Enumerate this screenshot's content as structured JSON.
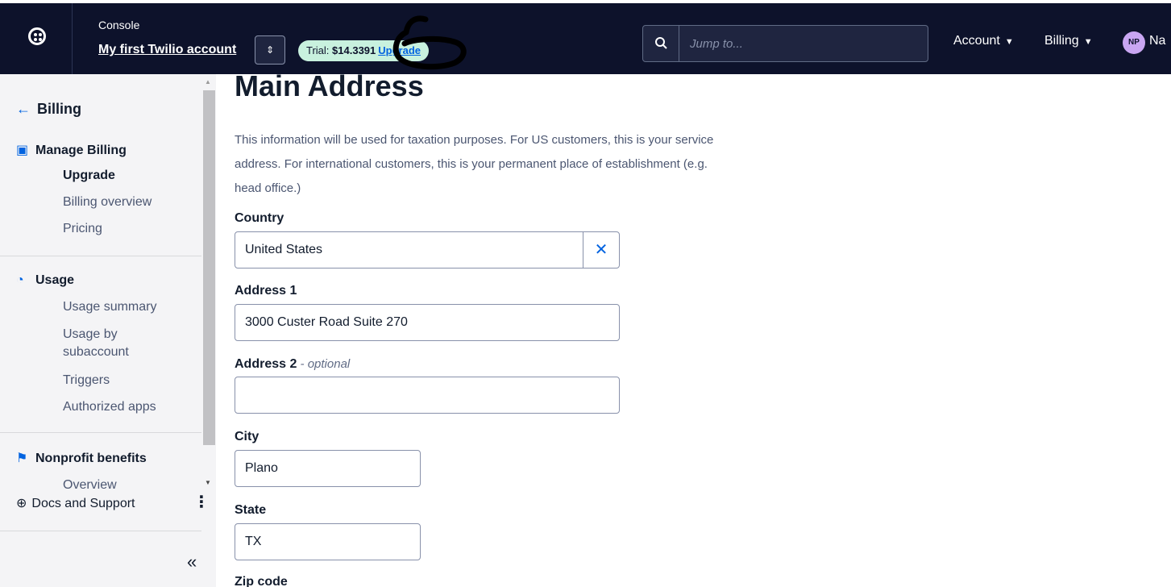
{
  "topbar": {
    "console_label": "Console",
    "account_name": "My first Twilio account",
    "switch_icon": "⌃⌄",
    "trial_label": "Trial: ",
    "trial_amount": "$14.3391",
    "upgrade_link": "Upgrade",
    "search_placeholder": "Jump to...",
    "menus": [
      {
        "label": "Account"
      },
      {
        "label": "Billing"
      }
    ],
    "avatar_initials": "NP",
    "user_name": "Na"
  },
  "sidebar": {
    "back_label": "Billing",
    "sections": [
      {
        "title": "Manage Billing",
        "icon": "money-icon",
        "items": [
          "Upgrade",
          "Billing overview",
          "Pricing"
        ]
      },
      {
        "title": "Usage",
        "icon": "gauge-icon",
        "items": [
          "Usage summary",
          "Usage by subaccount",
          "Triggers",
          "Authorized apps"
        ]
      },
      {
        "title": "Nonprofit benefits",
        "icon": "flag-icon",
        "items": [
          "Overview"
        ]
      }
    ],
    "docs_label": "Docs and Support"
  },
  "main": {
    "title": "Main Address",
    "intro": "This information will be used for taxation purposes. For US customers, this is your service address. For international customers, this is your permanent place of establishment (e.g. head office.)",
    "fields": {
      "country": {
        "label": "Country",
        "value": "United States"
      },
      "address1": {
        "label": "Address 1",
        "value": "3000 Custer Road Suite 270"
      },
      "address2": {
        "label": "Address 2",
        "optional": " - optional",
        "value": ""
      },
      "city": {
        "label": "City",
        "value": "Plano"
      },
      "state": {
        "label": "State",
        "value": "TX"
      },
      "zip": {
        "label": "Zip code"
      }
    }
  },
  "colors": {
    "topbar_bg": "#0d122b",
    "accent": "#0263e0",
    "trial_pill": "#c8f1de"
  }
}
